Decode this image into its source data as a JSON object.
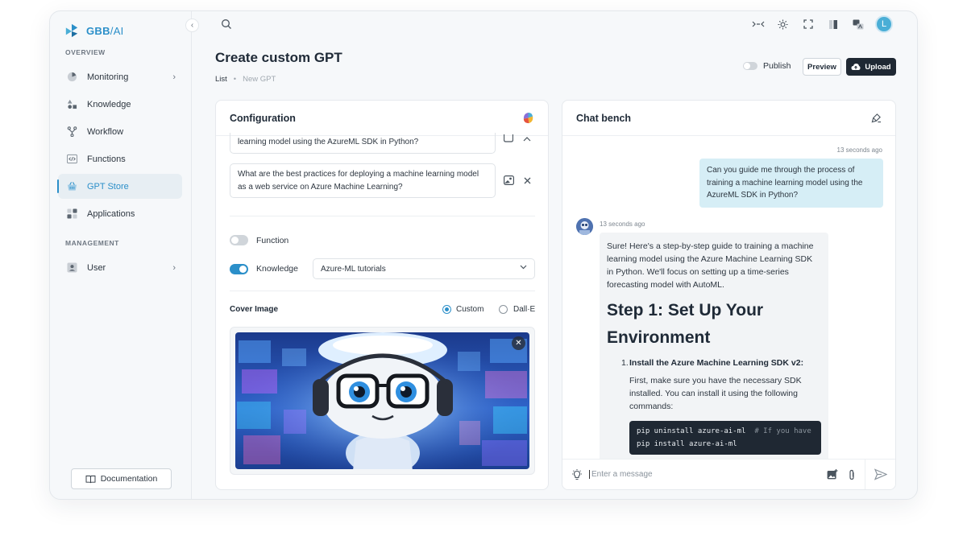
{
  "brand": {
    "name": "GBB",
    "suffix": "/AI"
  },
  "sidebar": {
    "sections": [
      {
        "label": "OVERVIEW"
      },
      {
        "label": "MANAGEMENT"
      }
    ],
    "items": [
      {
        "label": "Monitoring",
        "icon": "monitoring-icon",
        "has_chevron": true
      },
      {
        "label": "Knowledge",
        "icon": "shapes-icon"
      },
      {
        "label": "Workflow",
        "icon": "workflow-icon"
      },
      {
        "label": "Functions",
        "icon": "code-icon"
      },
      {
        "label": "GPT Store",
        "icon": "basket-icon",
        "active": true
      },
      {
        "label": "Applications",
        "icon": "apps-icon"
      },
      {
        "label": "User",
        "icon": "user-icon",
        "has_chevron": true
      }
    ],
    "documentation_label": "Documentation"
  },
  "topbar": {
    "avatar_initial": "L"
  },
  "page": {
    "title": "Create custom GPT",
    "breadcrumb": [
      "List",
      "New GPT"
    ],
    "publish_label": "Publish",
    "publish_on": false,
    "preview_label": "Preview",
    "upload_label": "Upload"
  },
  "config": {
    "title": "Configuration",
    "prompts": [
      "learning model using the AzureML SDK in Python?",
      "What are the best practices for deploying a machine learning model as a web service on Azure Machine Learning?"
    ],
    "function_label": "Function",
    "function_on": false,
    "knowledge_label": "Knowledge",
    "knowledge_on": true,
    "knowledge_value": "Azure-ML tutorials",
    "cover_label": "Cover Image",
    "cover_options": [
      "Custom",
      "Dall·E"
    ],
    "cover_selected": "Custom"
  },
  "chat": {
    "title": "Chat bench",
    "user_timestamp": "13 seconds ago",
    "user_message": "Can you guide me through the process of training a machine learning model using the AzureML SDK in Python?",
    "bot_timestamp": "13 seconds ago",
    "bot_intro": "Sure! Here's a step-by-step guide to training a machine learning model using the Azure Machine Learning SDK in Python. We'll focus on setting up a time-series forecasting model with AutoML.",
    "bot_heading": "Step 1: Set Up Your Environment",
    "bot_step_number": "1.",
    "bot_step_title": "Install the Azure Machine Learning SDK v2:",
    "bot_step_text": "First, make sure you have the necessary SDK installed. You can install it using the following commands:",
    "code_line1": "pip uninstall azure-ai-ml",
    "code_line1_comment": "# If you have",
    "code_line2": "pip install azure-ai-ml",
    "input_placeholder": "Enter a message"
  },
  "colors": {
    "accent": "#2b8fc9",
    "dark_button": "#1f2833",
    "user_bubble": "#d6eef6"
  }
}
